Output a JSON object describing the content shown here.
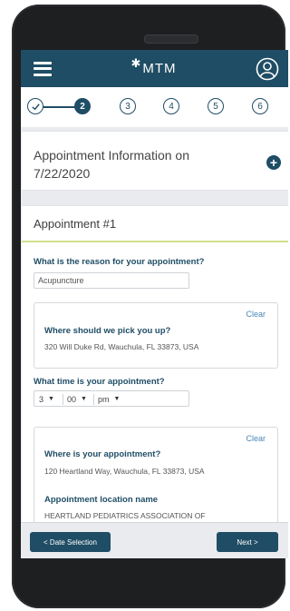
{
  "app": {
    "logo_text": "MTM",
    "logo_mark": "✱"
  },
  "stepper": {
    "steps": [
      {
        "label": "",
        "state": "done"
      },
      {
        "label": "2",
        "state": "active"
      },
      {
        "label": "3",
        "state": "pending"
      },
      {
        "label": "4",
        "state": "pending"
      },
      {
        "label": "5",
        "state": "pending"
      },
      {
        "label": "6",
        "state": "pending"
      }
    ]
  },
  "info_card": {
    "title": "Appointment Information on 7/22/2020",
    "add_icon": "+"
  },
  "appointment": {
    "heading": "Appointment #1",
    "reason_label": "What is the reason for your appointment?",
    "reason_value": "Acupuncture",
    "pickup": {
      "clear_label": "Clear",
      "label": "Where should we pick you up?",
      "address": "320 Will Duke Rd, Wauchula, FL 33873, USA"
    },
    "time_label": "What time is your appointment?",
    "time": {
      "hour": "3",
      "minute": "00",
      "meridiem": "pm"
    },
    "destination": {
      "clear_label": "Clear",
      "label": "Where is your appointment?",
      "address": "120 Heartland Way, Wauchula, FL 33873, USA",
      "location_name_label": "Appointment location name",
      "location_name_value": "HEARTLAND PEDIATRICS ASSOCIATION OF"
    }
  },
  "nav": {
    "back_label": "< Date Selection",
    "next_label": "Next >"
  },
  "colors": {
    "primary": "#1f4d65",
    "accent_line": "#cfe08a",
    "link": "#4a87b8"
  }
}
